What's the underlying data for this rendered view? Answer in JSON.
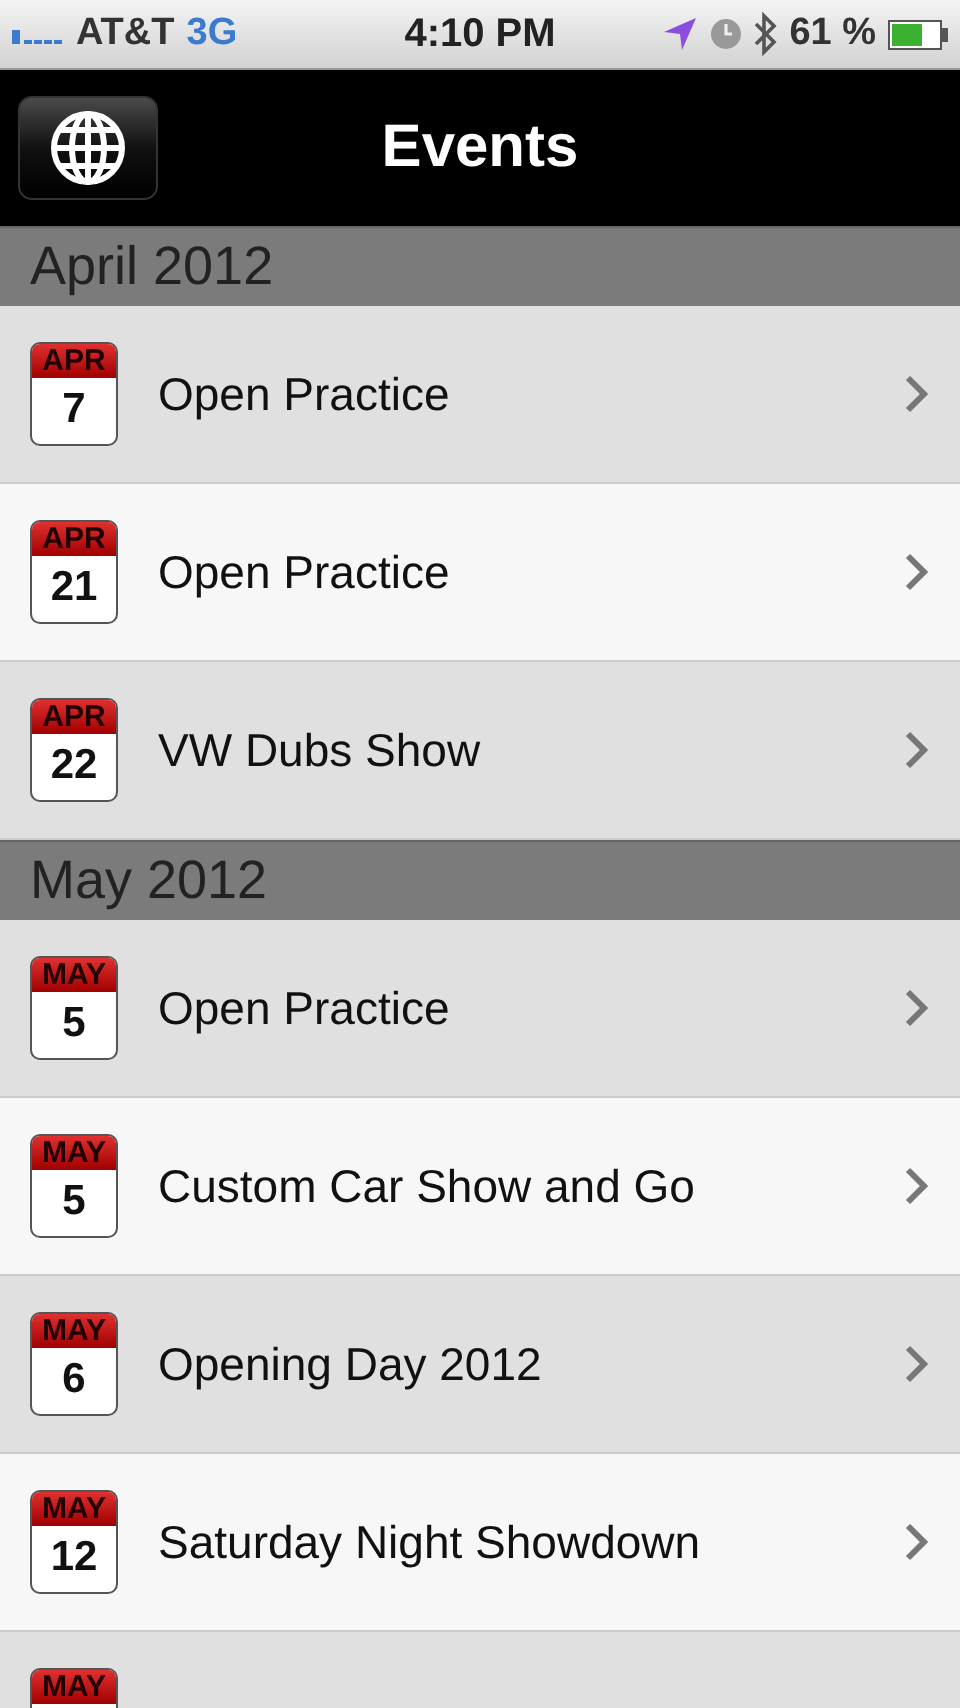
{
  "status_bar": {
    "carrier": "AT&T",
    "network": "3G",
    "time": "4:10 PM",
    "battery": "61 %"
  },
  "nav_bar": {
    "title": "Events"
  },
  "sections": [
    {
      "title": "April 2012",
      "events": [
        {
          "month": "APR",
          "day": "7",
          "title": "Open Practice"
        },
        {
          "month": "APR",
          "day": "21",
          "title": "Open Practice"
        },
        {
          "month": "APR",
          "day": "22",
          "title": "VW Dubs Show"
        }
      ]
    },
    {
      "title": "May 2012",
      "events": [
        {
          "month": "MAY",
          "day": "5",
          "title": "Open Practice"
        },
        {
          "month": "MAY",
          "day": "5",
          "title": "Custom Car Show and Go"
        },
        {
          "month": "MAY",
          "day": "6",
          "title": "Opening Day 2012"
        },
        {
          "month": "MAY",
          "day": "12",
          "title": "Saturday Night Showdown"
        },
        {
          "month": "MAY"
        }
      ]
    }
  ]
}
